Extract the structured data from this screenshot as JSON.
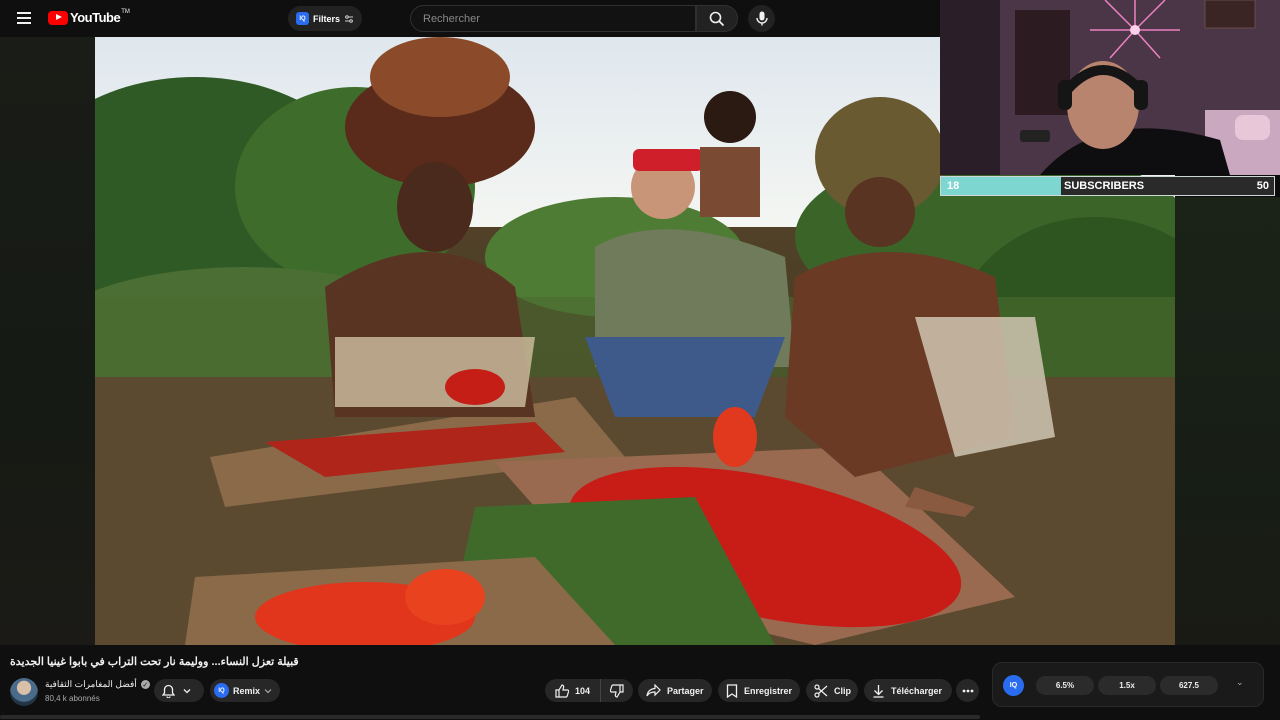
{
  "topbar": {
    "brand": "YouTube",
    "brand_tm": "TM",
    "filters_label": "Filters",
    "iq_badge": "IQ",
    "search_placeholder": "Rechercher"
  },
  "overlay": {
    "subscribers_current": "18",
    "subscribers_label": "SUBSCRIBERS",
    "subscribers_goal": "50",
    "subscribers_progress_fraction": 0.36
  },
  "video_info": {
    "title": "قبيلة تعزل النساء... ووليمة نار تحت التراب في بابوا غينيا الجديدة",
    "channel_name": "أفضل المغامرات الثقافية",
    "subscribers": "80,4 k abonnés",
    "remix_label": "Remix",
    "iq_badge": "IQ"
  },
  "actions": {
    "likes": "104",
    "share": "Partager",
    "save": "Enregistrer",
    "clip": "Clip",
    "download": "Télécharger"
  },
  "iq_panel": {
    "badge": "IQ",
    "stat1": "6.5%",
    "stat2": "1.5x",
    "stat3": "627.5"
  },
  "colors": {
    "accent_red": "#ff0000",
    "iq_blue": "#2a6cf0",
    "subscriber_fill": "#7ed6d0"
  },
  "icons": [
    "hamburger-icon",
    "youtube-logo",
    "filter-icon",
    "search-icon",
    "mic-icon",
    "bell-icon",
    "chevron-down-icon",
    "like-icon",
    "dislike-icon",
    "share-icon",
    "save-icon",
    "clip-icon",
    "download-icon",
    "more-icon",
    "verified-icon"
  ]
}
